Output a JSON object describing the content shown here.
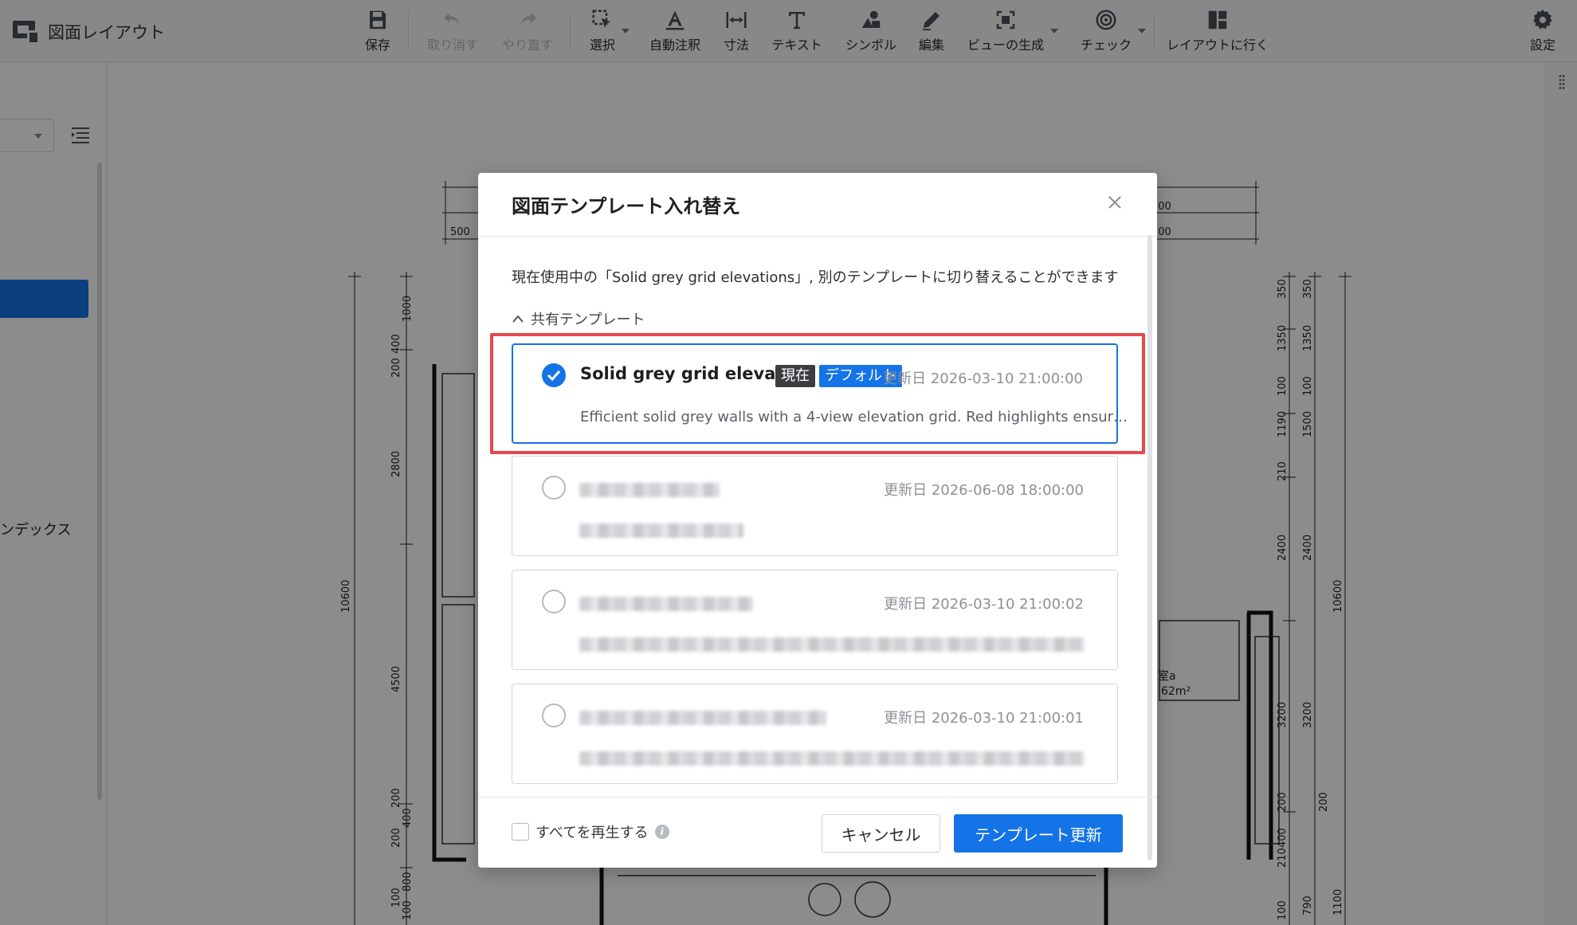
{
  "app": {
    "title": "図面レイアウト"
  },
  "toolbar": {
    "items": [
      {
        "label": "保存",
        "icon": "save-icon",
        "disabled": false
      },
      {
        "label": "取り消す",
        "icon": "undo-icon",
        "disabled": true
      },
      {
        "label": "やり直す",
        "icon": "redo-icon",
        "disabled": true
      },
      {
        "label": "選択",
        "icon": "select-icon",
        "disabled": false,
        "dropdown": true
      },
      {
        "label": "自動注釈",
        "icon": "auto-annotate-icon",
        "disabled": false
      },
      {
        "label": "寸法",
        "icon": "dimension-icon",
        "disabled": false
      },
      {
        "label": "テキスト",
        "icon": "text-icon",
        "disabled": false
      },
      {
        "label": "シンボル",
        "icon": "symbol-icon",
        "disabled": false
      },
      {
        "label": "編集",
        "icon": "edit-icon",
        "disabled": false
      },
      {
        "label": "ビューの生成",
        "icon": "generate-view-icon",
        "disabled": false,
        "dropdown": true
      },
      {
        "label": "チェック",
        "icon": "check-icon",
        "disabled": false,
        "dropdown": true
      },
      {
        "label": "レイアウトに行く",
        "icon": "go-layout-icon",
        "disabled": false
      }
    ],
    "settings_label": "設定"
  },
  "left_panel": {
    "partial_text": "ンデックス"
  },
  "dialog": {
    "title": "図面テンプレート入れ替え",
    "description": "現在使用中の「Solid grey grid elevations」, 別のテンプレートに切り替えることができます",
    "section_label": "共有テンプレート",
    "templates": [
      {
        "name": "Solid grey grid elevat…",
        "badges": [
          "現在",
          "デフォルト"
        ],
        "updated": "更新日 2026-03-10 21:00:00",
        "description": "Efficient solid grey walls with a 4-view elevation grid. Red highlights ensur…",
        "selected": true
      },
      {
        "name": "",
        "updated": "更新日 2026-06-08 18:00:00",
        "description": "",
        "selected": false
      },
      {
        "name": "",
        "updated": "更新日 2026-03-10 21:00:02",
        "description": "",
        "selected": false
      },
      {
        "name": "",
        "updated": "更新日 2026-03-10 21:00:01",
        "description": "",
        "selected": false
      }
    ],
    "regenerate_label": "すべてを再生する",
    "cancel_label": "キャンセル",
    "update_label": "テンプレート更新"
  },
  "colors": {
    "primary": "#1473e6",
    "highlight": "#e5484d",
    "badge_dark": "#3b3d41"
  },
  "drawing": {
    "dimension_labels": [
      "500",
      "200",
      "200",
      "1000",
      "200",
      "400",
      "2800",
      "10600",
      "4500",
      "200",
      "400",
      "200",
      "100",
      "800",
      "100",
      "350",
      "350",
      "1350",
      "1350",
      "100",
      "100",
      "1190",
      "1500",
      "210",
      "2400",
      "2400",
      "10600",
      "3200",
      "3200",
      "200",
      "400",
      "200",
      "210",
      "100",
      "790",
      "1100"
    ],
    "room_label": "室a",
    "room_area": "62m²"
  }
}
